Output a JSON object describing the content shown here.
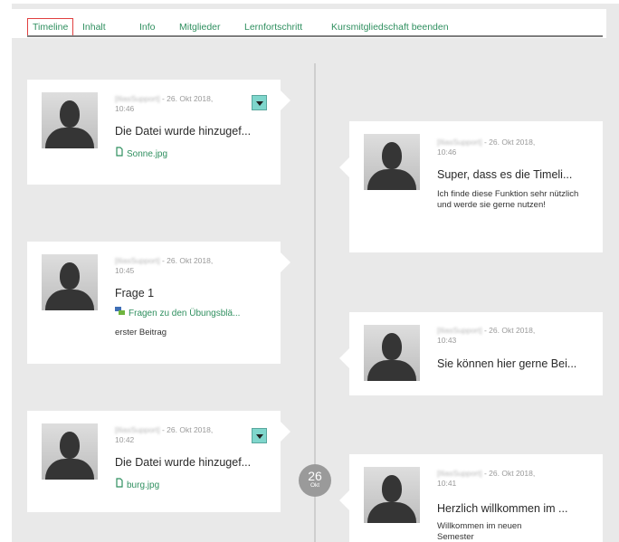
{
  "tabs": [
    {
      "label": "Timeline",
      "active": true
    },
    {
      "label": "Inhalt"
    },
    {
      "label": "Info"
    },
    {
      "label": "Mitglieder"
    },
    {
      "label": "Lernfortschritt"
    },
    {
      "label": "Kursmitgliedschaft beenden"
    }
  ],
  "date_badge": {
    "day": "26",
    "month": "Okt"
  },
  "posts": [
    {
      "user": "[IliasSupport]",
      "date_line1": " - 26. Okt 2018,",
      "date_line2": "10:46",
      "title": "Die Datei wurde hinzugef...",
      "link_icon": "file-icon",
      "link": "Sonne.jpg"
    },
    {
      "user": "[IliasSupport]",
      "date_line1": " - 26. Okt 2018,",
      "date_line2": "10:45",
      "title": "Frage 1",
      "link_icon": "forum-icon",
      "link": "Fragen zu den Übungsblä...",
      "description": "erster Beitrag"
    },
    {
      "user": "[IliasSupport]",
      "date_line1": " - 26. Okt 2018,",
      "date_line2": "10:42",
      "title": "Die Datei wurde hinzugef...",
      "link_icon": "file-icon",
      "link": "burg.jpg"
    },
    {
      "user": "[IliasSupport]",
      "date_line1": " - 26. Okt 2018,",
      "date_line2": "10:46",
      "title": "Super, dass es die Timeli...",
      "description": "Ich finde diese Funktion sehr nützlich und werde sie gerne nutzen!"
    },
    {
      "user": "[IliasSupport]",
      "date_line1": " - 26. Okt 2018,",
      "date_line2": "10:43",
      "title": "Sie können hier gerne Bei..."
    },
    {
      "user": "[IliasSupport]",
      "date_line1": " - 26. Okt 2018,",
      "date_line2": "10:41",
      "title": "Herzlich willkommen im ...",
      "description": "Willkommen im neuen Semester"
    }
  ],
  "colors": {
    "accent": "#2f8f5f",
    "active_tab_border": "#e04040",
    "menu_button": "#7fd6cc",
    "background": "#e9e9e9"
  }
}
